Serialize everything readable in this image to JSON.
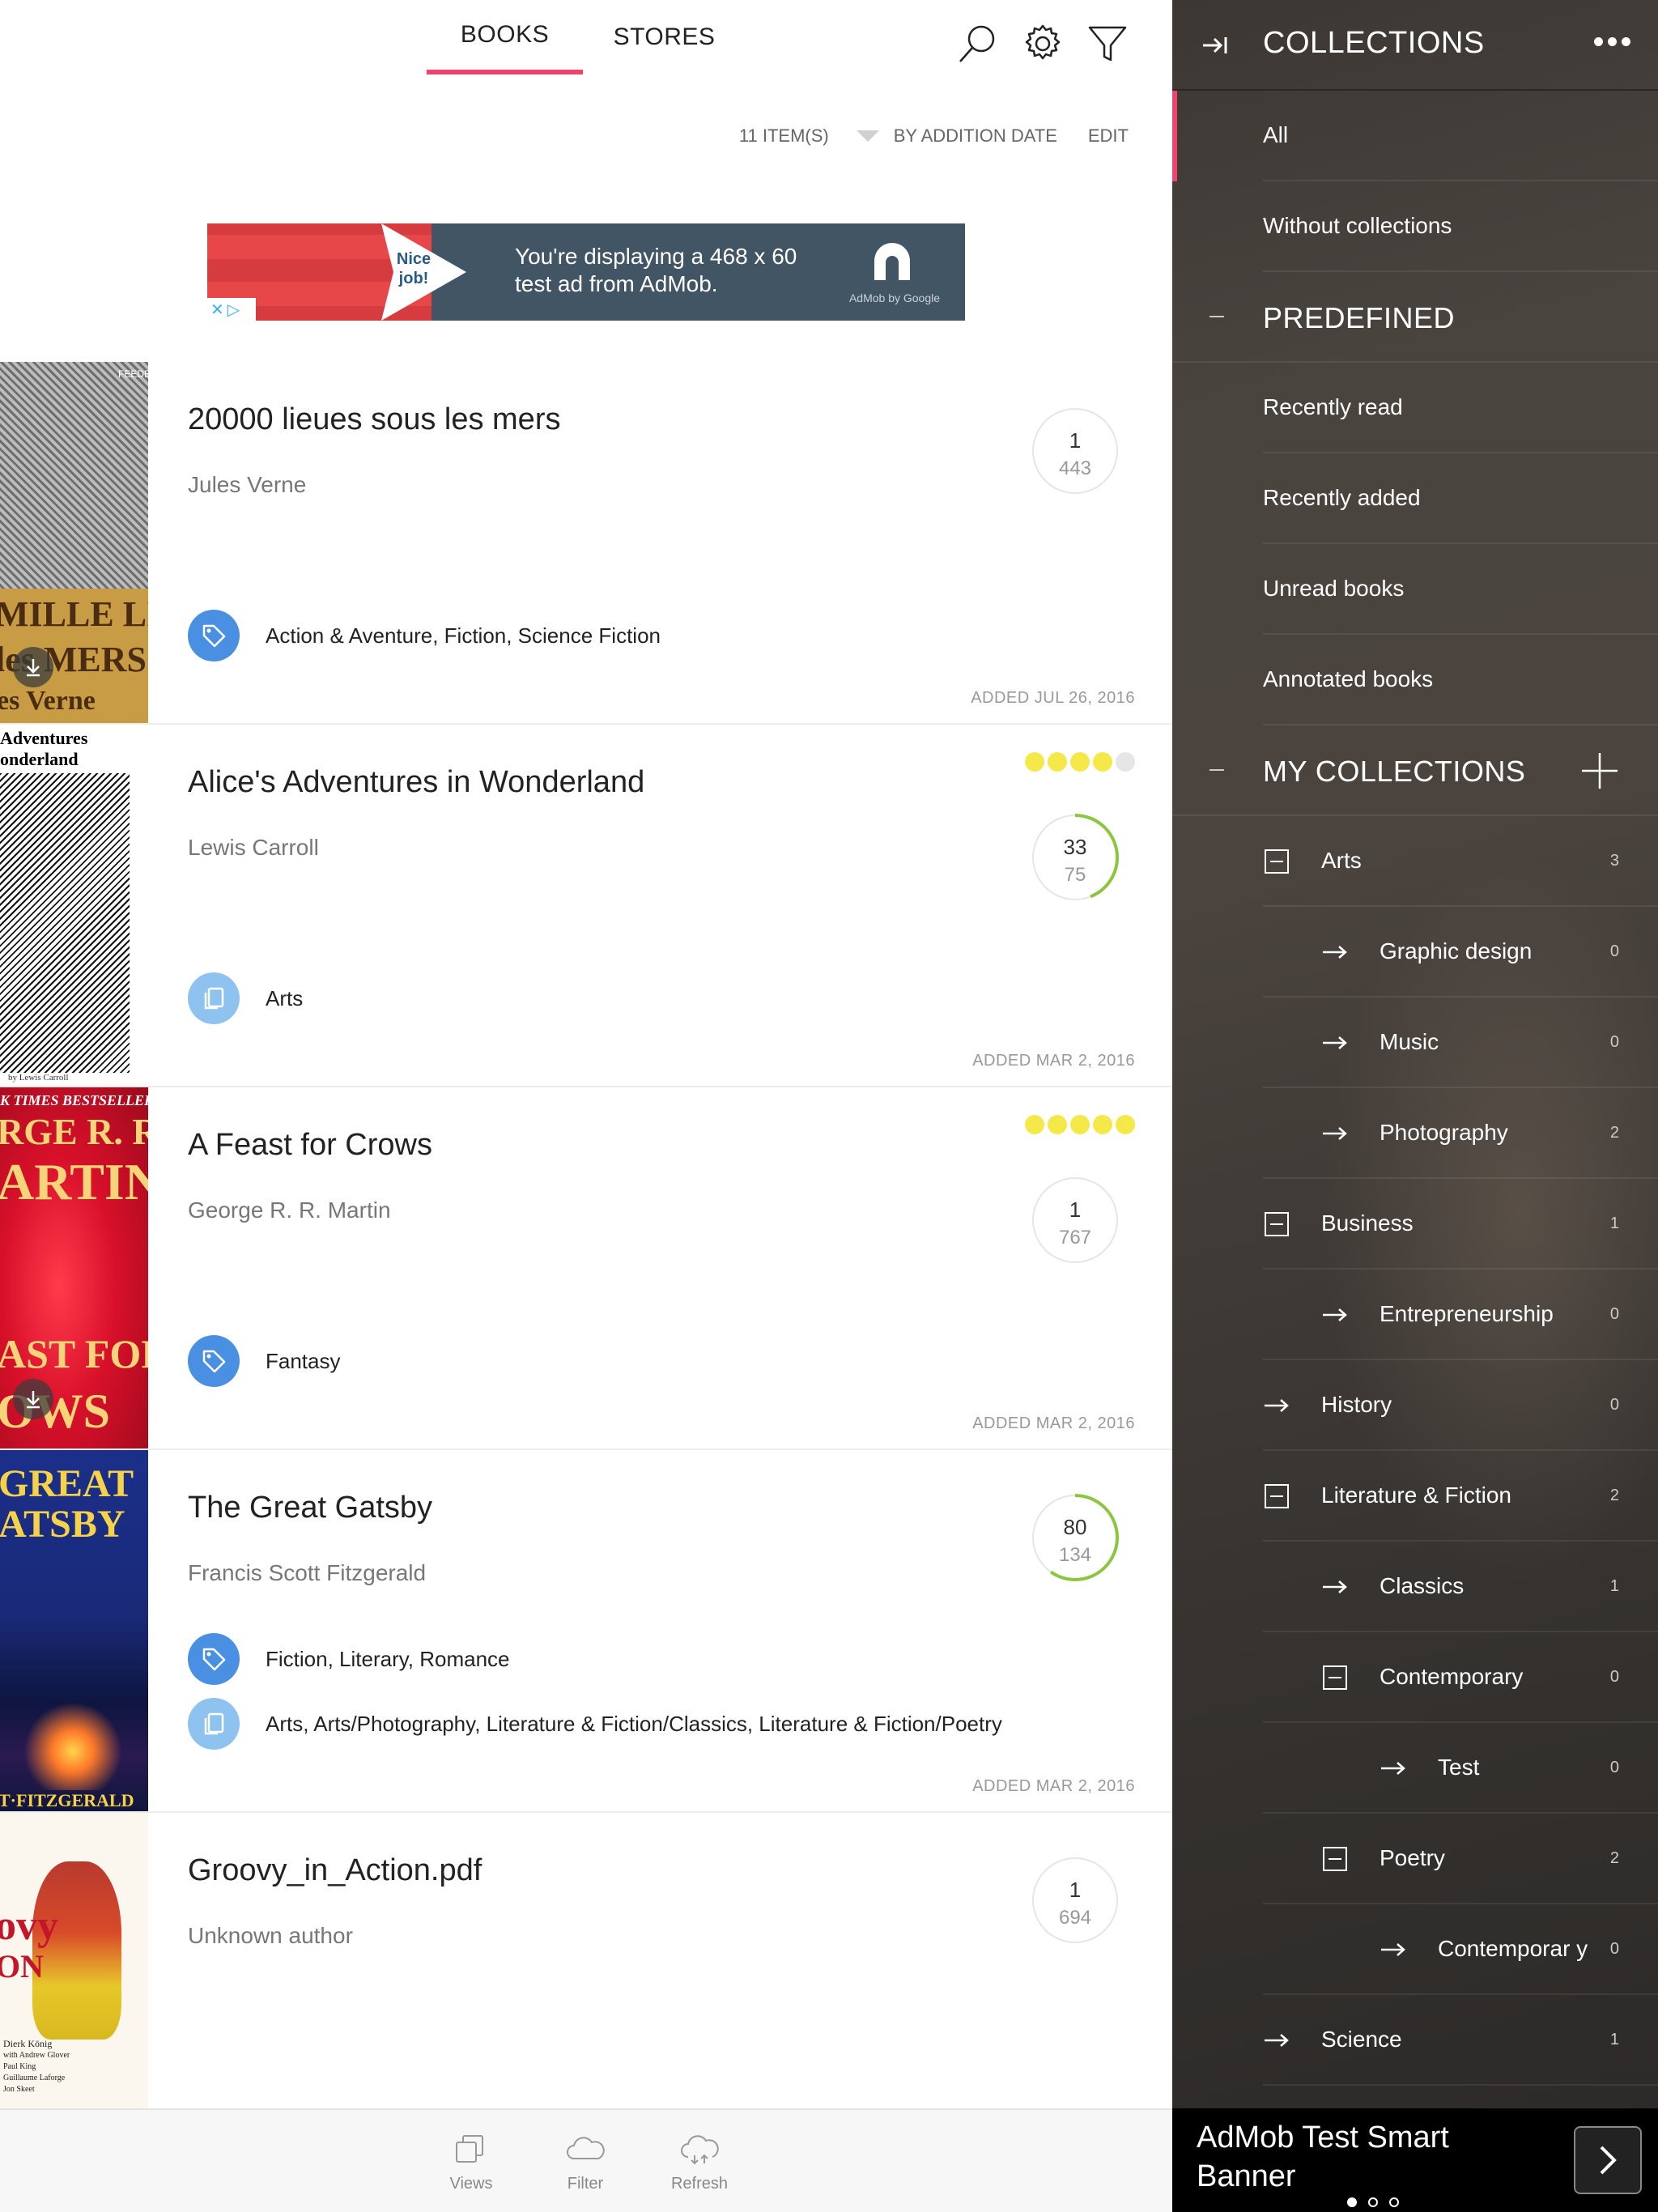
{
  "header": {
    "tabs": [
      {
        "label": "BOOKS",
        "active": true
      },
      {
        "label": "STORES",
        "active": false
      }
    ],
    "icons": [
      "search-icon",
      "gear-icon",
      "filter-icon"
    ]
  },
  "sortbar": {
    "count": "11 ITEM(S)",
    "sort_label": "BY ADDITION DATE",
    "edit_label": "EDIT"
  },
  "ad": {
    "badge": "Nice job!",
    "text": "You're displaying a 468 x 60 test ad from AdMob.",
    "logo_text": "AdMob by Google"
  },
  "books": [
    {
      "title": "20000 lieues sous les mers",
      "author": "Jules Verne",
      "progress_current": "1",
      "progress_total": "443",
      "rating": null,
      "tags": "Action & Aventure, Fiction, Science Fiction",
      "collections": null,
      "added": "ADDED JUL 26, 2016",
      "cover_lines": [
        "FEEDBOOKS",
        "MILLE LIEUES",
        "les MERS",
        "es Verne"
      ]
    },
    {
      "title": "Alice's Adventures in Wonderland",
      "author": "Lewis Carroll",
      "progress_current": "33",
      "progress_total": "75",
      "rating": 4,
      "tags": null,
      "collections": "Arts",
      "added": "ADDED MAR 2, 2016",
      "cover_lines": [
        "Adventures",
        "onderland",
        "by Lewis Carroll"
      ]
    },
    {
      "title": "A Feast for Crows",
      "author": "George R. R. Martin",
      "progress_current": "1",
      "progress_total": "767",
      "rating": 5,
      "tags": "Fantasy",
      "collections": null,
      "added": "ADDED MAR 2, 2016",
      "cover_lines": [
        "K TIMES BESTSELLER",
        "RGE R. R.",
        "ARTIN",
        "AST FOR",
        "OWS"
      ]
    },
    {
      "title": "The Great Gatsby",
      "author": "Francis Scott Fitzgerald",
      "progress_current": "80",
      "progress_total": "134",
      "rating": null,
      "tags": "Fiction, Literary, Romance",
      "collections": "Arts, Arts/Photography, Literature & Fiction/Classics, Literature & Fiction/Poetry",
      "added": "ADDED MAR 2, 2016",
      "cover_lines": [
        "GREAT",
        "ATSBY",
        "T·FITZGERALD"
      ]
    },
    {
      "title": "Groovy_in_Action.pdf",
      "author": "Unknown author",
      "progress_current": "1",
      "progress_total": "694",
      "rating": null,
      "tags": null,
      "collections": null,
      "added": "",
      "cover_lines": [
        "ovy",
        "ON",
        "Dierk König",
        "with Andrew Glover",
        "Paul King",
        "Guillaume Laforge",
        "Jon Skeet"
      ]
    }
  ],
  "bottombar": {
    "buttons": [
      {
        "label": "Views",
        "icon": "views-icon"
      },
      {
        "label": "Filter",
        "icon": "cloud-icon"
      },
      {
        "label": "Refresh",
        "icon": "cloud-refresh-icon"
      }
    ]
  },
  "sidebar": {
    "title": "COLLECTIONS",
    "top_items": [
      {
        "label": "All",
        "active": true
      },
      {
        "label": "Without collections"
      }
    ],
    "predefined_title": "PREDEFINED",
    "predefined": [
      "Recently read",
      "Recently added",
      "Unread books",
      "Annotated books"
    ],
    "my_title": "MY COLLECTIONS",
    "my_collections": [
      {
        "label": "Arts",
        "count": "3",
        "level": 0,
        "icon": "collapse"
      },
      {
        "label": "Graphic design",
        "count": "0",
        "level": 1,
        "icon": "arrow"
      },
      {
        "label": "Music",
        "count": "0",
        "level": 1,
        "icon": "arrow"
      },
      {
        "label": "Photography",
        "count": "2",
        "level": 1,
        "icon": "arrow"
      },
      {
        "label": "Business",
        "count": "1",
        "level": 0,
        "icon": "collapse"
      },
      {
        "label": "Entrepreneurship",
        "count": "0",
        "level": 1,
        "icon": "arrow"
      },
      {
        "label": "History",
        "count": "0",
        "level": 0,
        "icon": "arrow"
      },
      {
        "label": "Literature & Fiction",
        "count": "2",
        "level": 0,
        "icon": "collapse"
      },
      {
        "label": "Classics",
        "count": "1",
        "level": 1,
        "icon": "arrow"
      },
      {
        "label": "Contemporary",
        "count": "0",
        "level": 1,
        "icon": "collapse"
      },
      {
        "label": "Test",
        "count": "0",
        "level": 2,
        "icon": "arrow"
      },
      {
        "label": "Poetry",
        "count": "2",
        "level": 1,
        "icon": "collapse"
      },
      {
        "label": "Contemporar y",
        "count": "0",
        "level": 2,
        "icon": "arrow"
      },
      {
        "label": "Science",
        "count": "1",
        "level": 0,
        "icon": "arrow"
      }
    ]
  },
  "smart_banner": {
    "text": "AdMob Test Smart Banner"
  },
  "colors": {
    "accent": "#f0446d",
    "tag_blue": "#4a90e2",
    "collection_blue": "#8ec3f0",
    "rating_yellow": "#f5e949",
    "progress_green": "#8cc63f"
  }
}
